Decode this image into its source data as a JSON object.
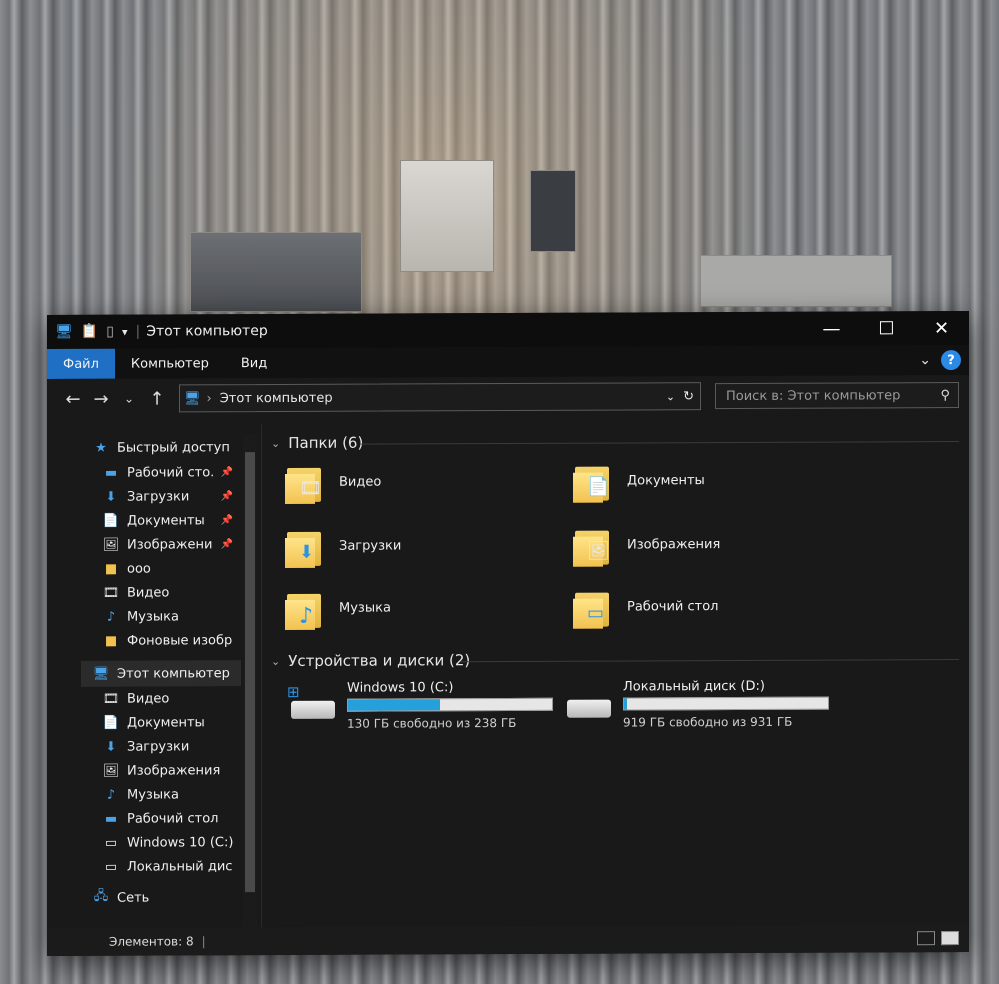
{
  "titlebar": {
    "title": "Этот компьютер",
    "icons": [
      "computer-icon",
      "properties-icon",
      "new-folder-icon",
      "dropdown-icon"
    ],
    "minimize": "—",
    "maximize": "☐",
    "close": "✕"
  },
  "ribbon": {
    "tabs": [
      "Файл",
      "Компьютер",
      "Вид"
    ],
    "active_tab": "Файл",
    "help": "?"
  },
  "nav": {
    "back": "←",
    "forward": "→",
    "recent": "⌄",
    "up": "↑",
    "address": "Этот компьютер",
    "search_placeholder": "Поиск в: Этот компьютер"
  },
  "sidebar": {
    "quick_access": "Быстрый доступ",
    "pinned": [
      {
        "label": "Рабочий сто.",
        "icon": "desktop-icon",
        "pinned": true
      },
      {
        "label": "Загрузки",
        "icon": "download-icon",
        "pinned": true
      },
      {
        "label": "Документы",
        "icon": "document-icon",
        "pinned": true
      },
      {
        "label": "Изображени",
        "icon": "pictures-icon",
        "pinned": true
      },
      {
        "label": "ооо",
        "icon": "folder-icon",
        "pinned": false
      },
      {
        "label": "Видео",
        "icon": "video-icon",
        "pinned": false
      },
      {
        "label": "Музыка",
        "icon": "music-icon",
        "pinned": false
      },
      {
        "label": "Фоновые изобр",
        "icon": "folder-icon",
        "pinned": false
      }
    ],
    "this_pc": "Этот компьютер",
    "pc_items": [
      {
        "label": "Видео",
        "icon": "video-icon"
      },
      {
        "label": "Документы",
        "icon": "document-icon"
      },
      {
        "label": "Загрузки",
        "icon": "download-icon"
      },
      {
        "label": "Изображения",
        "icon": "pictures-icon"
      },
      {
        "label": "Музыка",
        "icon": "music-icon"
      },
      {
        "label": "Рабочий стол",
        "icon": "desktop-icon"
      },
      {
        "label": "Windows 10 (C:)",
        "icon": "drive-icon"
      },
      {
        "label": "Локальный дис",
        "icon": "drive-icon"
      }
    ],
    "network": "Сеть"
  },
  "content": {
    "folders_header": "Папки (6)",
    "folders": [
      {
        "label": "Видео",
        "icon": "video-folder-icon",
        "badge": "🎞"
      },
      {
        "label": "Документы",
        "icon": "documents-folder-icon",
        "badge": "📄"
      },
      {
        "label": "Загрузки",
        "icon": "downloads-folder-icon",
        "badge": "⬇"
      },
      {
        "label": "Изображения",
        "icon": "pictures-folder-icon",
        "badge": "🖼"
      },
      {
        "label": "Музыка",
        "icon": "music-folder-icon",
        "badge": "♪"
      },
      {
        "label": "Рабочий стол",
        "icon": "desktop-folder-icon",
        "badge": "▭"
      }
    ],
    "drives_header": "Устройства и диски (2)",
    "drives": [
      {
        "name": "Windows 10 (C:)",
        "free": "130 ГБ свободно из 238 ГБ",
        "used_fraction": 0.45,
        "system": true
      },
      {
        "name": "Локальный диск (D:)",
        "free": "919 ГБ свободно из 931 ГБ",
        "used_fraction": 0.013,
        "system": false
      }
    ]
  },
  "status": {
    "count": "Элементов: 8"
  },
  "colors": {
    "accent": "#1f6fc4",
    "drive_bar": "#26a0da",
    "window_bg": "#191919"
  }
}
